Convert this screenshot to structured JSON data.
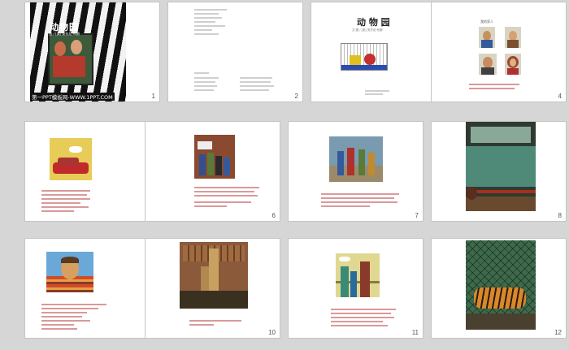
{
  "slides": [
    {
      "number": "1",
      "cover_title": "动物园",
      "cover_sub": "文·图 / [英] 安东尼·布朗",
      "banner": "第一PPT模板网-WWW.1PPT.COM"
    },
    {
      "number": "2"
    },
    {
      "number": "3",
      "title": "动 物 园",
      "subtitle": "文·图 / [英] 安东尼·布朗"
    },
    {
      "number": "4",
      "caption": "我的家人"
    },
    {
      "number": "5"
    },
    {
      "number": "6"
    },
    {
      "number": "7"
    },
    {
      "number": "8"
    },
    {
      "number": "9"
    },
    {
      "number": "10"
    },
    {
      "number": "11"
    },
    {
      "number": "12"
    }
  ]
}
